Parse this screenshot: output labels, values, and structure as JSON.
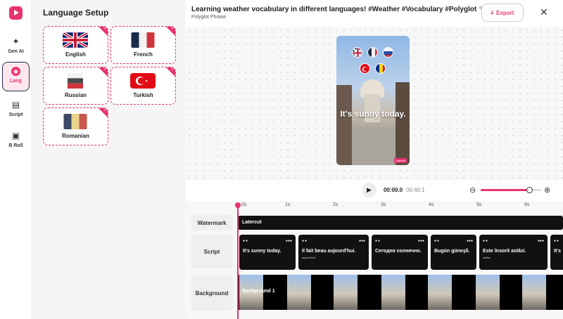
{
  "sidebar": {
    "items": [
      {
        "key": "gen_ai",
        "label": "Gen AI",
        "icon": "sparkle-icon"
      },
      {
        "key": "lang",
        "label": "Lang",
        "icon": "globe-icon",
        "active": true
      },
      {
        "key": "script",
        "label": "Script",
        "icon": "document-icon"
      },
      {
        "key": "broll",
        "label": "B Roll",
        "icon": "film-icon"
      }
    ]
  },
  "language_panel": {
    "title": "Language Setup",
    "languages": [
      {
        "name": "English",
        "flag": "uk-flag-icon",
        "selected": true
      },
      {
        "name": "French",
        "flag": "france-flag-icon",
        "selected": true
      },
      {
        "name": "Russian",
        "flag": "russia-flag-icon",
        "selected": true
      },
      {
        "name": "Turkish",
        "flag": "turkey-flag-icon",
        "selected": true
      },
      {
        "name": "Romanian",
        "flag": "romania-flag-icon",
        "selected": true
      }
    ]
  },
  "topbar": {
    "title": "Learning weather vocabulary in different languages! #Weather #Vocabulary #Polyglot",
    "subtitle": "Polyglot Phrase",
    "export_label": "Export"
  },
  "preview": {
    "caption": "It's sunny today.",
    "watermark": "Latercut"
  },
  "controls": {
    "time_current": "00:00.0",
    "time_total": "00:40.1",
    "zoom_level": 0.8
  },
  "timeline": {
    "ruler": [
      "0s",
      "1s",
      "2s",
      "3s",
      "4s",
      "5s",
      "6s"
    ],
    "rows": {
      "watermark": "Watermark",
      "script": "Script",
      "background": "Background"
    },
    "watermark_text": "Latercut",
    "script_clips": [
      {
        "text": "It's sunny today.",
        "sub": ""
      },
      {
        "text": "Il fait beau aujourd'hui.",
        "sub": "aujourd'hui"
      },
      {
        "text": "Сегодня солнечно.",
        "sub": ""
      },
      {
        "text": "Bugün güneşli.",
        "sub": ""
      },
      {
        "text": "Este însorit astăzi.",
        "sub": "astăzi."
      },
      {
        "text": "It's",
        "sub": ""
      }
    ],
    "background_label": "Background 1"
  },
  "colors": {
    "accent": "#e8336f",
    "dark": "#111111"
  }
}
